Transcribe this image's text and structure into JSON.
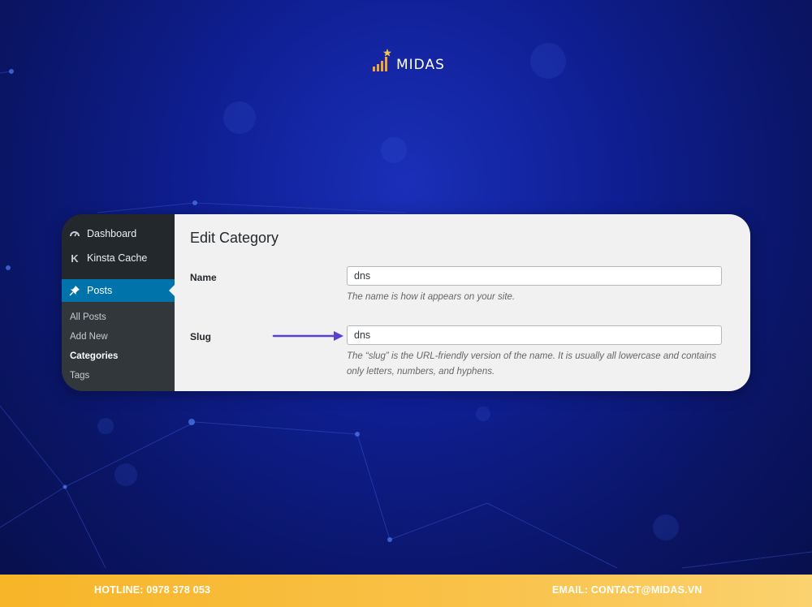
{
  "brand": {
    "name": "MIDAS"
  },
  "sidebar": {
    "items": [
      {
        "label": "Dashboard",
        "icon": "dashboard-icon"
      },
      {
        "label": "Kinsta Cache",
        "icon": "kinsta-icon"
      },
      {
        "label": "Posts",
        "icon": "pin-icon",
        "active": true
      }
    ],
    "submenu": [
      {
        "label": "All Posts"
      },
      {
        "label": "Add New"
      },
      {
        "label": "Categories",
        "current": true
      },
      {
        "label": "Tags"
      }
    ]
  },
  "form": {
    "title": "Edit Category",
    "name_label": "Name",
    "name_value": "dns",
    "name_desc": "The name is how it appears on your site.",
    "slug_label": "Slug",
    "slug_value": "dns",
    "slug_desc": "The “slug” is the URL-friendly version of the name. It is usually all lowercase and contains only letters, numbers, and hyphens."
  },
  "footer": {
    "hotline": "HOTLINE: 0978 378 053",
    "email": "EMAIL: CONTACT@MIDAS.VN"
  },
  "colors": {
    "background": "#0f1f94",
    "sidebar": "#23282d",
    "active_menu": "#0073aa",
    "arrow": "#5a3fd6",
    "footer": "#f7b528"
  }
}
